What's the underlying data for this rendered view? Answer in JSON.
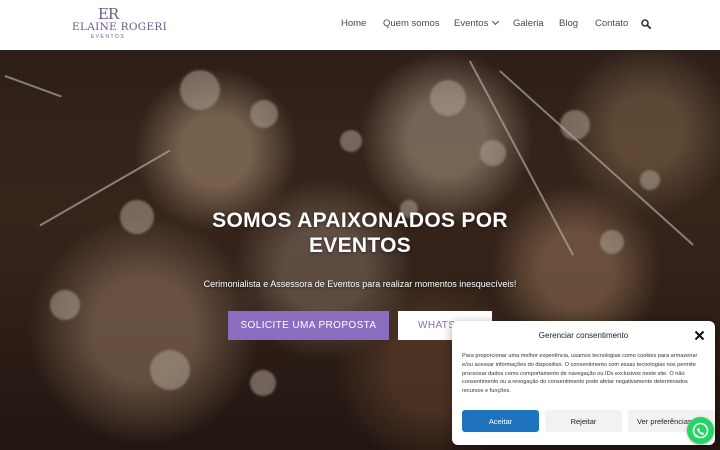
{
  "brand": {
    "monogram": "ER",
    "name": "ELAINE ROGERI",
    "tagline": "EVENTOS",
    "accent": "#8a6dbf"
  },
  "nav": {
    "items": [
      {
        "label": "Home"
      },
      {
        "label": "Quem somos"
      },
      {
        "label": "Eventos"
      },
      {
        "label": "Galeria"
      },
      {
        "label": "Blog"
      },
      {
        "label": "Contato"
      }
    ],
    "search_icon": "search-icon"
  },
  "hero": {
    "title_line1": "SOMOS APAIXONADOS POR",
    "title_line2": "EVENTOS",
    "subtitle": "Cerimonialista e Assessora de Eventos para realizar momentos inesquecíveis!",
    "primary_button": "SOLICITE UMA PROPOSTA",
    "secondary_button": "WHATSAPP"
  },
  "consent": {
    "title": "Gerenciar consentimento",
    "text": "Para proporcionar uma melhor experiência, usamos tecnologias como cookies para armazenar e/ou acessar informações do dispositivo. O consentimento com essas tecnologias nos permite processar dados como comportamento de navegação ou IDs exclusivos neste site. O não consentimento ou a revogação do consentimento pode afetar negativamente determinados recursos e funções.",
    "accept": "Aceitar",
    "reject": "Rejeitar",
    "preferences": "Ver preferências",
    "accept_color": "#1e73be"
  },
  "floating": {
    "whatsapp_icon": "whatsapp-icon",
    "color": "#25d366"
  }
}
